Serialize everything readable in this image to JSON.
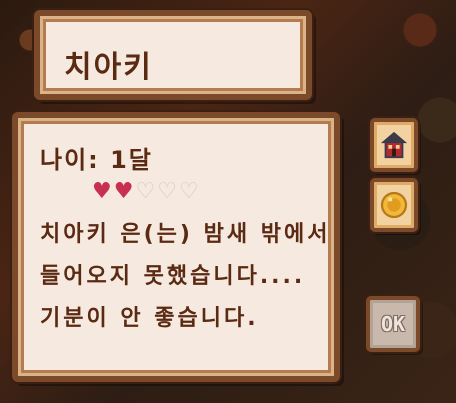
{
  "animal": {
    "name": "치아키",
    "age_text": "나이: 1달",
    "hearts": {
      "filled": 2,
      "total": 5,
      "filled_color": "#c73050",
      "empty_color": "#d8c8c0"
    },
    "description": "치아키 은(는) 밤새 밖에서 들어오지 못했습니다.... 기분이 안 좋습니다."
  },
  "buttons": {
    "home": {
      "icon": "house-icon"
    },
    "coin": {
      "icon": "coin-icon"
    },
    "ok": {
      "label": "OK"
    }
  }
}
